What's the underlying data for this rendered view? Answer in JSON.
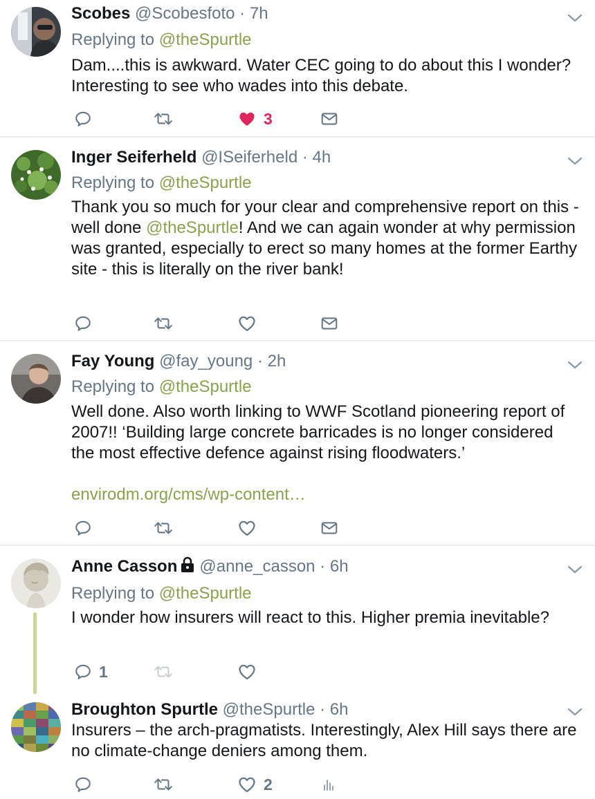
{
  "accent_color": "#8ba14a",
  "like_color": "#e0245e",
  "tweets": [
    {
      "name": "Scobes",
      "handle": "@Scobesfoto",
      "sep": "·",
      "time": "7h",
      "replying_label": "Replying to",
      "replying_to": "@theSpurtle",
      "text": "Dam....this is awkward. Water CEC going to do about this I wonder? Interesting to see who wades into this debate.",
      "likes": "3"
    },
    {
      "name": "Inger Seiferheld",
      "handle": "@ISeiferheld",
      "sep": "·",
      "time": "4h",
      "replying_label": "Replying to",
      "replying_to": "@theSpurtle",
      "text_part1": "Thank you so much for your clear and comprehensive report on this - well done ",
      "text_mention": "@theSpurtle",
      "text_part2": "! And we can again wonder at why permission was granted, especially to erect so many homes at the former Earthy site - this is literally on the river bank!"
    },
    {
      "name": "Fay Young",
      "handle": "@fay_young",
      "sep": "·",
      "time": "2h",
      "replying_label": "Replying to",
      "replying_to": "@theSpurtle",
      "text": "Well done. Also worth linking to WWF Scotland pioneering report of 2007!! ‘Building large concrete barricades is no longer considered the most effective defence against rising floodwaters.’",
      "link": "envirodm.org/cms/wp-content…"
    },
    {
      "name": "Anne Casson",
      "handle": "@anne_casson",
      "sep": "·",
      "time": "6h",
      "replying_label": "Replying to",
      "replying_to": "@theSpurtle",
      "text": "I wonder how insurers will react to this.  Higher premia inevitable?",
      "replies": "1"
    },
    {
      "name": "Broughton Spurtle",
      "handle": "@theSpurtle",
      "sep": "·",
      "time": "6h",
      "text": "Insurers – the arch-pragmatists. Interestingly, Alex Hill says there are no climate-change deniers among them.",
      "likes": "2"
    }
  ]
}
